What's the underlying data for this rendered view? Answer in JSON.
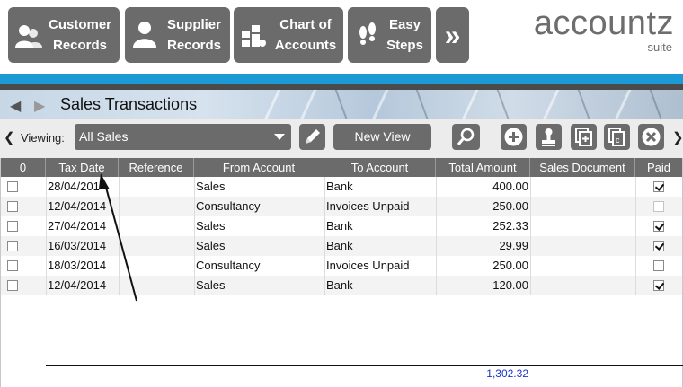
{
  "nav": {
    "customer_records": "Customer\nRecords",
    "supplier_records": "Supplier\nRecords",
    "chart_of_accounts": "Chart of\nAccounts",
    "easy_steps": "Easy\nSteps",
    "more": "»"
  },
  "brand": {
    "name": "accountz",
    "sub": "suite"
  },
  "page": {
    "title": "Sales Transactions"
  },
  "toolbar": {
    "viewing_label": "Viewing:",
    "view_value": "All Sales",
    "new_view_label": "New View"
  },
  "grid": {
    "columns": [
      "0",
      "Tax Date",
      "Reference",
      "From Account",
      "To Account",
      "Total Amount",
      "Sales Document",
      "Paid"
    ],
    "rows": [
      {
        "selected": false,
        "tax_date": "28/04/201",
        "reference": "",
        "from": "Sales",
        "to": "Bank",
        "amount": "400.00",
        "document": "",
        "paid": true
      },
      {
        "selected": false,
        "tax_date": "12/04/2014",
        "reference": "",
        "from": "Consultancy",
        "to": "Invoices Unpaid",
        "amount": "250.00",
        "document": "",
        "paid": false
      },
      {
        "selected": false,
        "tax_date": "27/04/2014",
        "reference": "",
        "from": "Sales",
        "to": "Bank",
        "amount": "252.33",
        "document": "",
        "paid": true
      },
      {
        "selected": false,
        "tax_date": "16/03/2014",
        "reference": "",
        "from": "Sales",
        "to": "Bank",
        "amount": "29.99",
        "document": "",
        "paid": true
      },
      {
        "selected": false,
        "tax_date": "18/03/2014",
        "reference": "",
        "from": "Consultancy",
        "to": "Invoices Unpaid",
        "amount": "250.00",
        "document": "",
        "paid": false
      },
      {
        "selected": false,
        "tax_date": "12/04/2014",
        "reference": "",
        "from": "Sales",
        "to": "Bank",
        "amount": "120.00",
        "document": "",
        "paid": true
      }
    ],
    "total": "1,302.32"
  },
  "colors": {
    "button_grey": "#6b6b6b",
    "accent_blue": "#1c9ad6",
    "total_blue": "#1a35c9"
  }
}
